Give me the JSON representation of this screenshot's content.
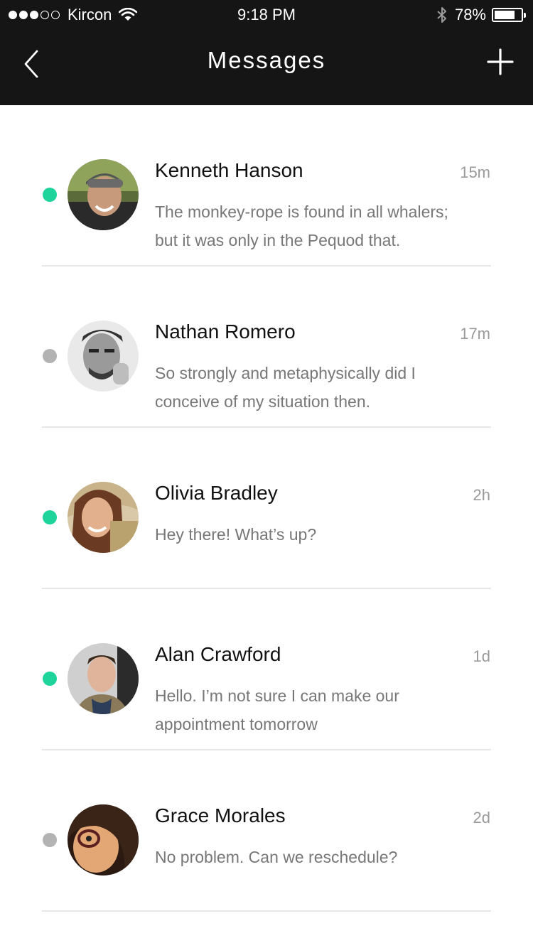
{
  "status_bar": {
    "signal_strength": 3,
    "signal_total": 5,
    "carrier": "Kircon",
    "time": "9:18 PM",
    "battery_percent": "78%",
    "battery_level": 0.78
  },
  "header": {
    "title": "Messages",
    "back_icon": "chevron-left-icon",
    "add_icon": "plus-icon"
  },
  "colors": {
    "online": "#1ed49a",
    "offline": "#b3b3b3",
    "header_bg": "#151515"
  },
  "conversations": [
    {
      "name": "Kenneth Hanson",
      "time_ago": "15m",
      "preview": "The monkey-rope is found in all whalers; but it was only in the Pequod that.",
      "online": true
    },
    {
      "name": "Nathan Romero",
      "time_ago": "17m",
      "preview": "So strongly and metaphysically did I conceive of my situation then.",
      "online": false
    },
    {
      "name": "Olivia Bradley",
      "time_ago": "2h",
      "preview": "Hey there! What’s up?",
      "online": true
    },
    {
      "name": "Alan Crawford",
      "time_ago": "1d",
      "preview": "Hello. I’m not sure I can make our appointment tomorrow",
      "online": true
    },
    {
      "name": "Grace Morales",
      "time_ago": "2d",
      "preview": "No problem. Can we reschedule?",
      "online": false
    }
  ]
}
